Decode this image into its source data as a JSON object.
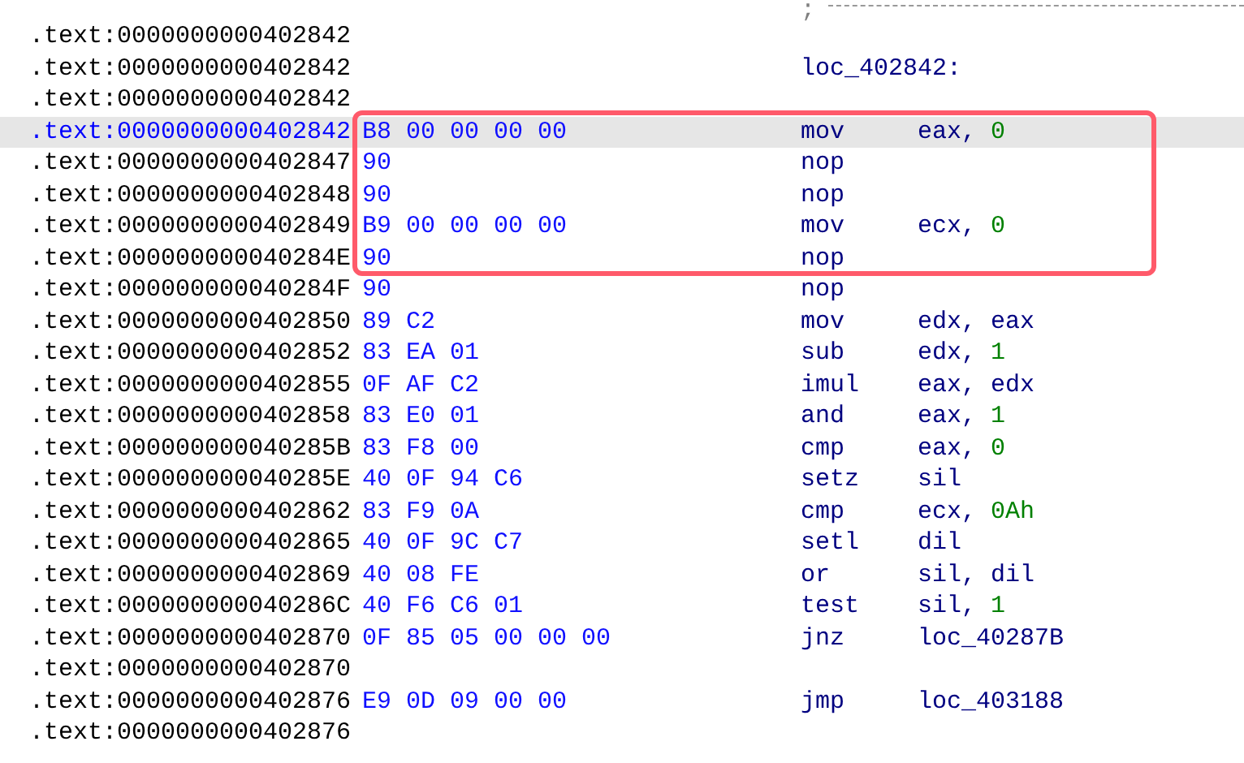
{
  "listing": {
    "rows": [
      {
        "kind": "separator",
        "comment": ";",
        "selected": false
      },
      {
        "kind": "blank",
        "address": ".text:0000000000402842",
        "selected": false
      },
      {
        "kind": "label",
        "address": ".text:0000000000402842",
        "label": "loc_402842:",
        "selected": false
      },
      {
        "kind": "blank",
        "address": ".text:0000000000402842",
        "selected": false
      },
      {
        "kind": "instr",
        "address": ".text:0000000000402842",
        "bytes": "B8 00 00 00 00",
        "mnemonic": "mov",
        "operands": "eax, ",
        "immediate": "0",
        "selected": true
      },
      {
        "kind": "instr",
        "address": ".text:0000000000402847",
        "bytes": "90",
        "mnemonic": "nop",
        "selected": false
      },
      {
        "kind": "instr",
        "address": ".text:0000000000402848",
        "bytes": "90",
        "mnemonic": "nop",
        "selected": false
      },
      {
        "kind": "instr",
        "address": ".text:0000000000402849",
        "bytes": "B9 00 00 00 00",
        "mnemonic": "mov",
        "operands": "ecx, ",
        "immediate": "0",
        "selected": false
      },
      {
        "kind": "instr",
        "address": ".text:000000000040284E",
        "bytes": "90",
        "mnemonic": "nop",
        "selected": false
      },
      {
        "kind": "instr",
        "address": ".text:000000000040284F",
        "bytes": "90",
        "mnemonic": "nop",
        "selected": false
      },
      {
        "kind": "instr",
        "address": ".text:0000000000402850",
        "bytes": "89 C2",
        "mnemonic": "mov",
        "operands": "edx, eax",
        "selected": false
      },
      {
        "kind": "instr",
        "address": ".text:0000000000402852",
        "bytes": "83 EA 01",
        "mnemonic": "sub",
        "operands": "edx, ",
        "immediate": "1",
        "selected": false
      },
      {
        "kind": "instr",
        "address": ".text:0000000000402855",
        "bytes": "0F AF C2",
        "mnemonic": "imul",
        "operands": "eax, edx",
        "selected": false
      },
      {
        "kind": "instr",
        "address": ".text:0000000000402858",
        "bytes": "83 E0 01",
        "mnemonic": "and",
        "operands": "eax, ",
        "immediate": "1",
        "selected": false
      },
      {
        "kind": "instr",
        "address": ".text:000000000040285B",
        "bytes": "83 F8 00",
        "mnemonic": "cmp",
        "operands": "eax, ",
        "immediate": "0",
        "selected": false
      },
      {
        "kind": "instr",
        "address": ".text:000000000040285E",
        "bytes": "40 0F 94 C6",
        "mnemonic": "setz",
        "operands": "sil",
        "selected": false
      },
      {
        "kind": "instr",
        "address": ".text:0000000000402862",
        "bytes": "83 F9 0A",
        "mnemonic": "cmp",
        "operands": "ecx, ",
        "immediate": "0Ah",
        "selected": false
      },
      {
        "kind": "instr",
        "address": ".text:0000000000402865",
        "bytes": "40 0F 9C C7",
        "mnemonic": "setl",
        "operands": "dil",
        "selected": false
      },
      {
        "kind": "instr",
        "address": ".text:0000000000402869",
        "bytes": "40 08 FE",
        "mnemonic": "or",
        "operands": "sil, dil",
        "selected": false
      },
      {
        "kind": "instr",
        "address": ".text:000000000040286C",
        "bytes": "40 F6 C6 01",
        "mnemonic": "test",
        "operands": "sil, ",
        "immediate": "1",
        "selected": false
      },
      {
        "kind": "instr",
        "address": ".text:0000000000402870",
        "bytes": "0F 85 05 00 00 00",
        "mnemonic": "jnz",
        "operands": "loc_40287B",
        "selected": false
      },
      {
        "kind": "blank",
        "address": ".text:0000000000402870",
        "selected": false
      },
      {
        "kind": "instr",
        "address": ".text:0000000000402876",
        "bytes": "E9 0D 09 00 00",
        "mnemonic": "jmp",
        "operands": "loc_403188",
        "selected": false
      },
      {
        "kind": "blank",
        "address": ".text:0000000000402876",
        "selected": false
      }
    ]
  }
}
